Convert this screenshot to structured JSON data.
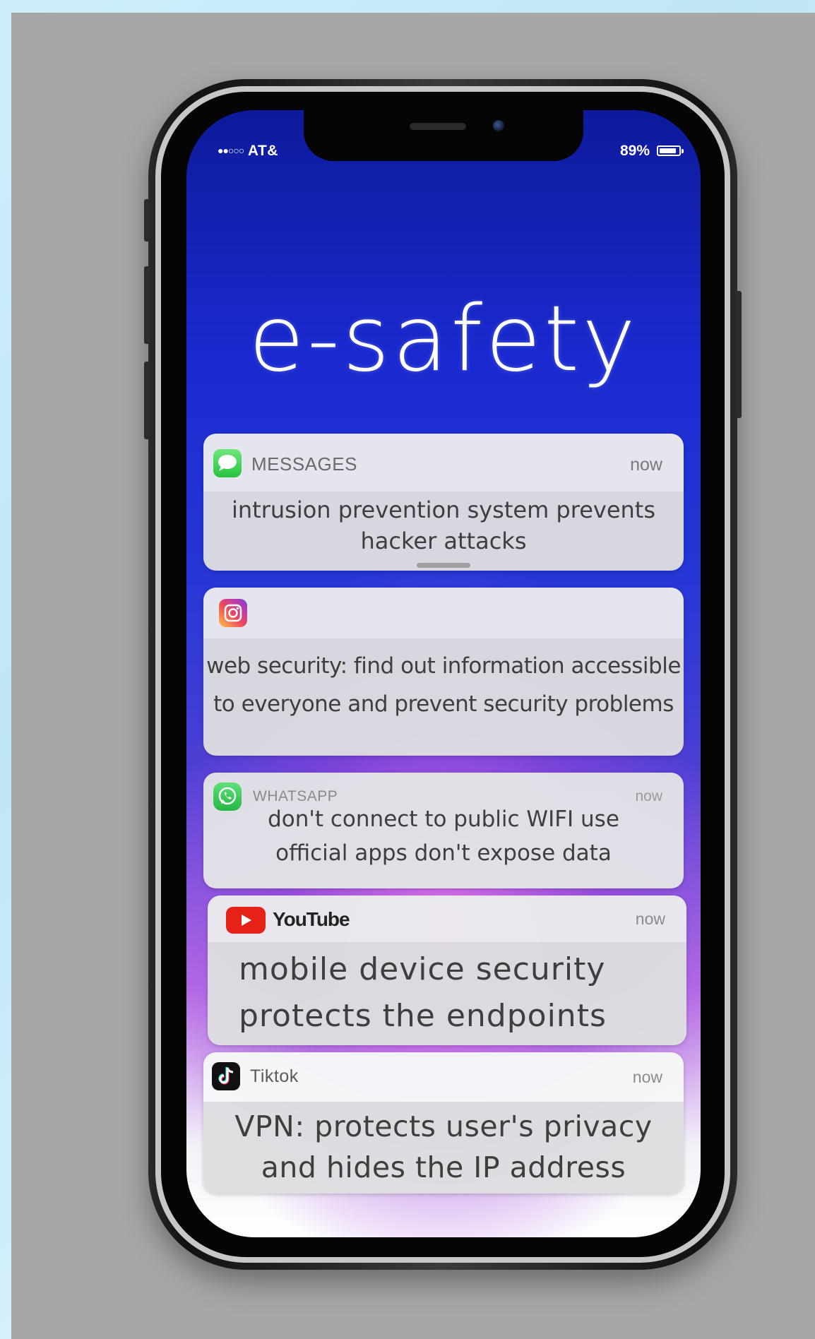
{
  "status_bar": {
    "signal_dots": "●●○○○",
    "carrier": "AT&",
    "battery_pct": "89%",
    "battery_level": 0.89
  },
  "title": "e-safety",
  "notifications": [
    {
      "app": "MESSAGES",
      "icon": "messages-icon",
      "time": "now",
      "body_line1": "intrusion  prevention  system  prevents",
      "body_line2": "hacker  attacks"
    },
    {
      "app": "",
      "icon": "instagram-icon",
      "time": "",
      "body_line1": "web  security:  find  out  information  accessible",
      "body_line2": "to  everyone  and  prevent  security  problems"
    },
    {
      "app": "WHATSAPP",
      "icon": "whatsapp-icon",
      "time": "now",
      "body_line1": "don't  connect  to  public  WIFI   use",
      "body_line2": "official  apps   don't  expose  data"
    },
    {
      "app": "YouTube",
      "icon": "youtube-icon",
      "time": "now",
      "body_line1": "mobile  device  security",
      "body_line2": "protects  the  endpoints"
    },
    {
      "app": "Tiktok",
      "icon": "tiktok-icon",
      "time": "now",
      "body_line1": "VPN:  protects  user's  privacy",
      "body_line2": "and  hides  the  IP  address"
    }
  ]
}
